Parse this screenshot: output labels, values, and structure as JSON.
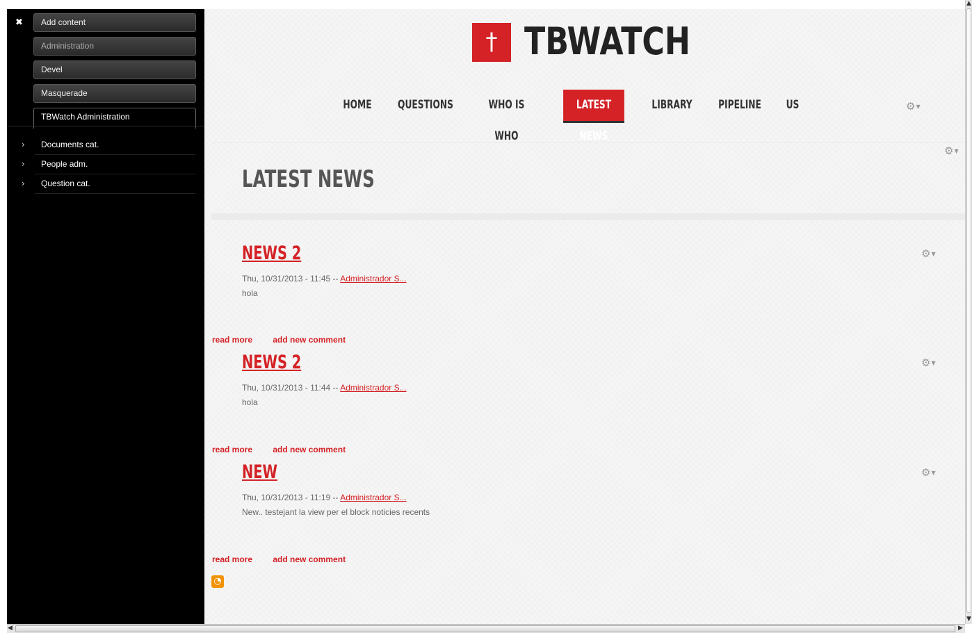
{
  "toolbar": {
    "close_glyph": "✖",
    "tabs": [
      {
        "label": "Add content"
      },
      {
        "label": "Administration"
      },
      {
        "label": "Devel"
      },
      {
        "label": "Masquerade"
      },
      {
        "label": "TBWatch Administration"
      }
    ],
    "shortcuts": [
      {
        "label": "Documents cat."
      },
      {
        "label": "People adm."
      },
      {
        "label": "Question cat."
      }
    ]
  },
  "site": {
    "logo_glyph": "†",
    "name": "TBWATCH"
  },
  "nav": {
    "items": [
      {
        "label": "HOME"
      },
      {
        "label": "QUESTIONS"
      },
      {
        "label": "WHO IS WHO"
      },
      {
        "label": "LATEST NEWS"
      },
      {
        "label": "LIBRARY"
      },
      {
        "label": "PIPELINE"
      },
      {
        "label": "US"
      }
    ],
    "active": "LATEST NEWS"
  },
  "page": {
    "title": "LATEST NEWS"
  },
  "news": [
    {
      "title": "NEWS 2",
      "date": "Thu, 10/31/2013 - 11:45 -- ",
      "author": "Administrador S...",
      "body": "hola",
      "read_more": "read more",
      "add_comment": "add new comment"
    },
    {
      "title": "NEWS 2",
      "date": "Thu, 10/31/2013 - 11:44 -- ",
      "author": "Administrador S...",
      "body": "hola",
      "read_more": "read more",
      "add_comment": "add new comment"
    },
    {
      "title": "NEW",
      "date": "Thu, 10/31/2013 - 11:19 -- ",
      "author": "Administrador S...",
      "body": "New.. testejant la view per el block noticies recents",
      "read_more": "read more",
      "add_comment": "add new comment"
    }
  ],
  "colors": {
    "accent": "#d42226",
    "toolbar_bg": "#000000",
    "page_bg": "#f5f5f5"
  },
  "icons": {
    "gear": "gear-icon",
    "rss": "rss-feed-icon"
  }
}
